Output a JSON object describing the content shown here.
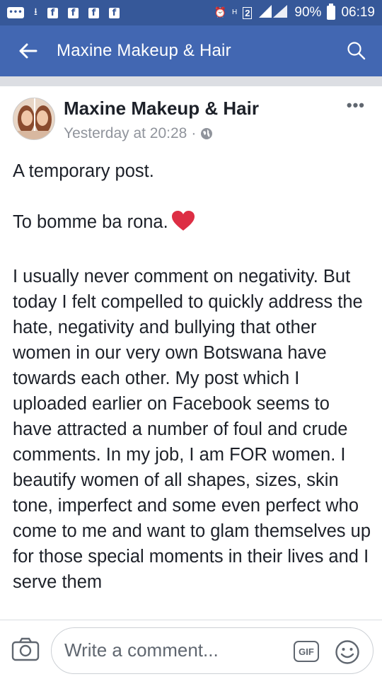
{
  "status_bar": {
    "battery": "90%",
    "time": "06:19",
    "network_h": "H",
    "sim_slot": "2"
  },
  "app_bar": {
    "title": "Maxine Makeup & Hair"
  },
  "post": {
    "author": "Maxine Makeup & Hair",
    "timestamp": "Yesterday at 20:28",
    "separator": "·",
    "paragraphs": [
      "A temporary post.",
      "To bomme ba rona.",
      "I usually never comment on negativity. But today I felt compelled to quickly address the hate, negativity and bullying that other women in our very own Botswana have towards each other. My post which I uploaded earlier on Facebook seems to have attracted a number of foul and crude comments. In my job, I am FOR women. I beautify women of all shapes, sizes, skin tone, imperfect and some even perfect who come to me and want to glam themselves up for those special moments in their lives and I serve them"
    ]
  },
  "comment_bar": {
    "placeholder": "Write a comment...",
    "gif_label": "GIF"
  },
  "icons": {
    "back": "arrow-left-icon",
    "search": "search-icon",
    "globe": "globe-icon",
    "heart": "red-heart-icon",
    "camera": "camera-icon",
    "emoji": "smiley-icon"
  },
  "colors": {
    "status_bar": "#365899",
    "app_bar": "#4267b2",
    "heart": "#dd2e44"
  }
}
